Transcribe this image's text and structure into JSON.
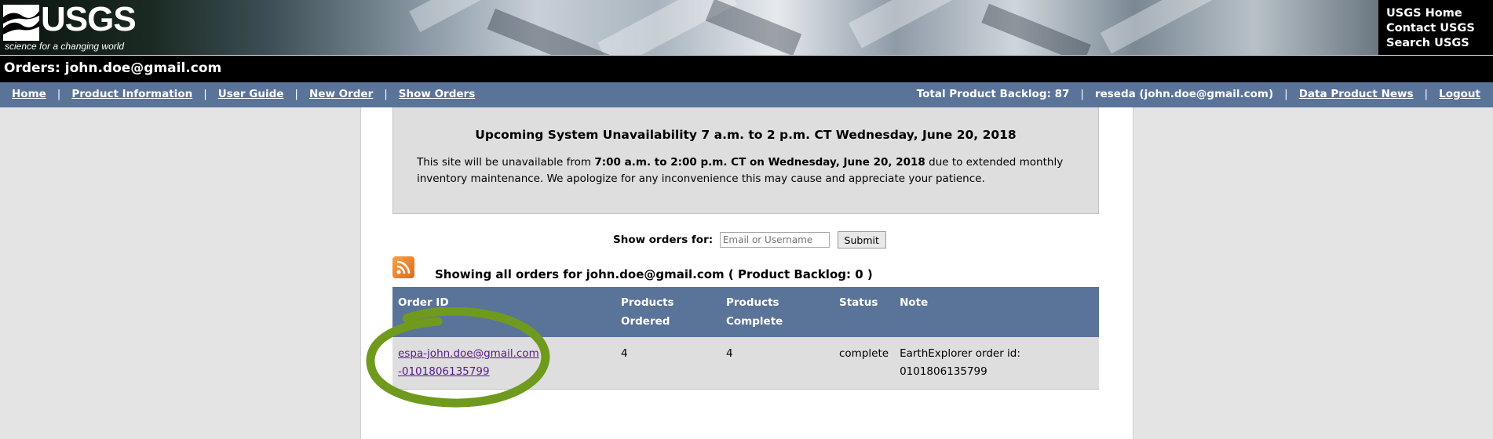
{
  "header": {
    "logo_text": "USGS",
    "tagline": "science for a changing world",
    "links": [
      "USGS Home",
      "Contact USGS",
      "Search USGS"
    ]
  },
  "page_title": "Orders: john.doe@gmail.com",
  "nav": {
    "left": [
      "Home",
      "Product Information",
      "User Guide",
      "New Order",
      "Show Orders"
    ],
    "backlog": "Total Product Backlog: 87",
    "user": "reseda (john.doe@gmail.com)",
    "news": "Data Product News",
    "logout": "Logout"
  },
  "notice": {
    "title": "Upcoming System Unavailability 7 a.m. to 2 p.m. CT Wednesday, June 20, 2018",
    "body_pre": "This site will be unavailable from ",
    "body_bold": "7:00 a.m. to 2:00 p.m. CT on Wednesday, June 20, 2018",
    "body_post": " due to extended monthly inventory maintenance. We apologize for any inconvenience this may cause and appreciate your patience."
  },
  "filter": {
    "label": "Show orders for:",
    "placeholder": "Email or Username",
    "submit": "Submit"
  },
  "showing": "Showing all orders for john.doe@gmail.com ( Product Backlog: 0 )",
  "table": {
    "headers": [
      "Order ID",
      "Products Ordered",
      "Products Complete",
      "Status",
      "Note"
    ],
    "rows": [
      {
        "order_id": "espa-john.doe@gmail.com-0101806135799",
        "ordered": "4",
        "complete": "4",
        "status": "complete",
        "note": "EarthExplorer order id: 0101806135799"
      }
    ]
  },
  "colors": {
    "nav_blue": "#5a7399",
    "highlight_green": "#6f9a1e",
    "rss_orange": "#f08a2c"
  }
}
